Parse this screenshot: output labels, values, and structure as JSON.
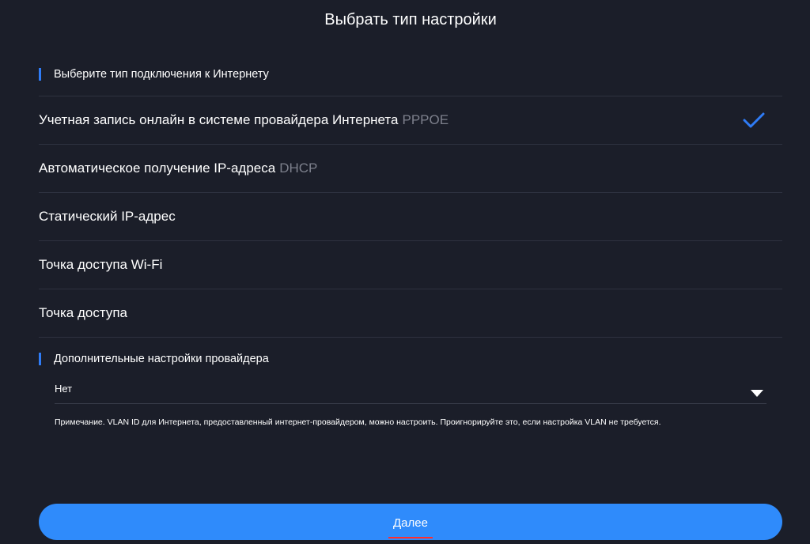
{
  "page": {
    "title": "Выбрать тип настройки"
  },
  "connection_section": {
    "label": "Выберите тип подключения к Интернету",
    "options": [
      {
        "label": "Учетная запись онлайн в системе провайдера Интернета",
        "suffix": "PPPOE",
        "selected": true
      },
      {
        "label": "Автоматическое получение IP-адреса",
        "suffix": "DHCP",
        "selected": false
      },
      {
        "label": "Статический IP-адрес",
        "suffix": "",
        "selected": false
      },
      {
        "label": "Точка доступа Wi-Fi",
        "suffix": "",
        "selected": false
      },
      {
        "label": "Точка доступа",
        "suffix": "",
        "selected": false
      }
    ]
  },
  "isp_section": {
    "label": "Дополнительные настройки провайдера",
    "dropdown_value": "Нет",
    "note": "Примечание. VLAN ID для Интернета, предоставленный интернет-провайдером, можно настроить. Проигнорируйте это, если настройка VLAN не требуется."
  },
  "footer": {
    "next_label": "Далее"
  },
  "icons": {
    "selected": "check-icon",
    "dropdown": "caret-down-icon"
  },
  "colors": {
    "background": "#1b1e29",
    "accent": "#2f7cf6",
    "button": "#2f8bfb",
    "muted_text": "#7d808c",
    "underline": "#ff2d2d"
  }
}
